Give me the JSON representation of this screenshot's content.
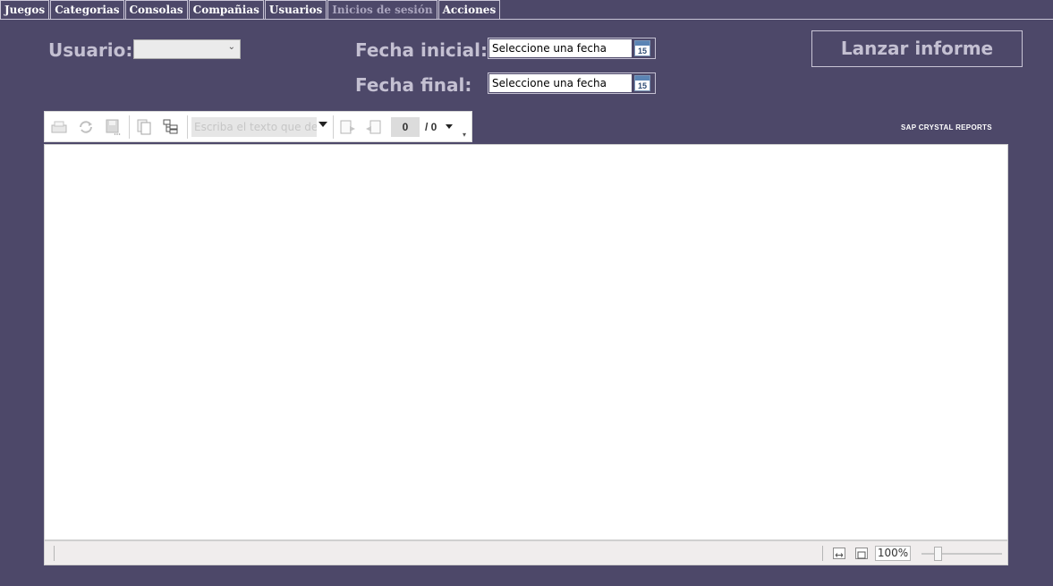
{
  "tabs": [
    {
      "label": "Juegos"
    },
    {
      "label": "Categorias"
    },
    {
      "label": "Consolas"
    },
    {
      "label": "Compañias"
    },
    {
      "label": "Usuarios"
    },
    {
      "label": "Inicios de sesión",
      "active": true
    },
    {
      "label": "Acciones"
    }
  ],
  "filters": {
    "user_label": "Usuario:",
    "user_value": "",
    "start_label": "Fecha inicial:",
    "start_value": "Seleccione una fecha",
    "end_label": "Fecha final:",
    "end_value": "Seleccione una fecha",
    "calendar_day": "15"
  },
  "launch_button": "Lanzar informe",
  "viewer": {
    "search_placeholder": "Escriba el texto que des",
    "current_page": "0",
    "total_pages": "/ 0",
    "brand": "SAP CRYSTAL REPORTS",
    "zoom": "100%"
  },
  "colors": {
    "background": "#4d4869",
    "label": "#c4c0d2",
    "tab_text": "#ffffff",
    "tab_active_text": "#a9a4bd"
  },
  "icons": [
    "print-icon",
    "refresh-icon",
    "save-icon",
    "copy-icon",
    "tree-icon",
    "export-icon",
    "import-icon",
    "fit-width-icon",
    "fit-page-icon",
    "calendar-icon"
  ]
}
